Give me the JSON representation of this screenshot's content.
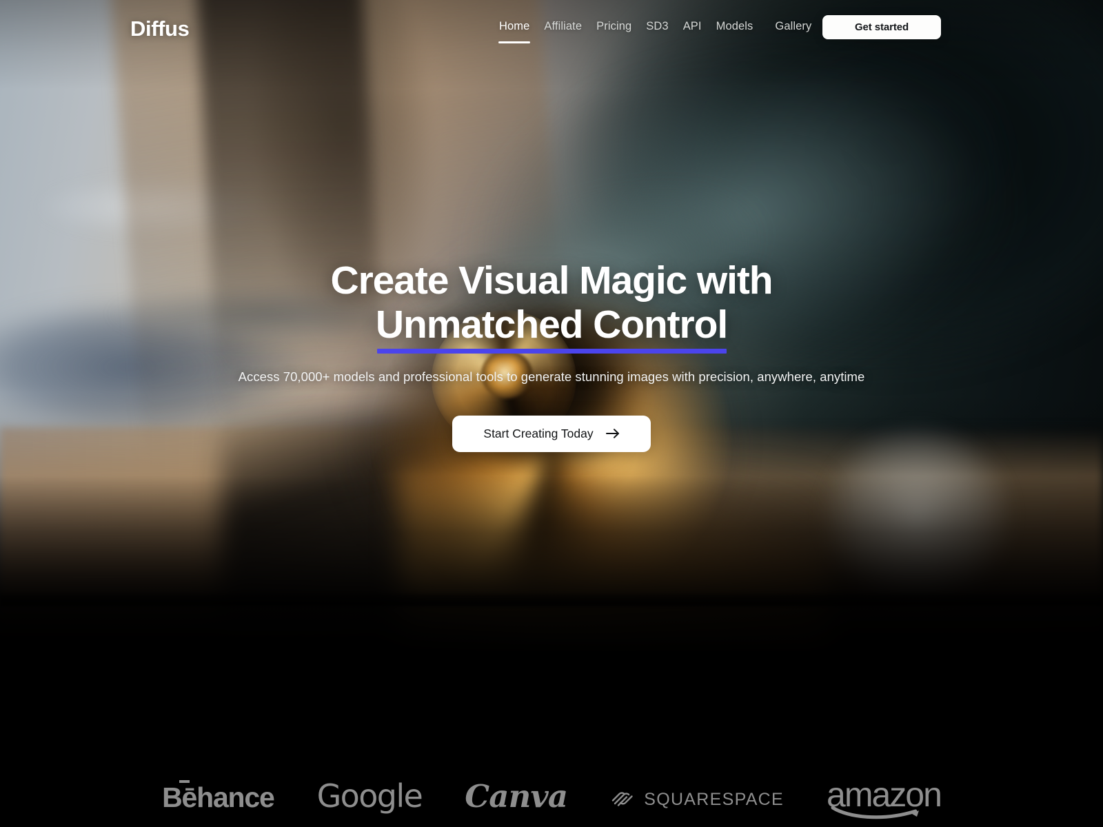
{
  "brand": {
    "logo_text": "Diffus"
  },
  "nav": {
    "links": [
      {
        "label": "Home",
        "active": true
      },
      {
        "label": "Affiliate",
        "active": false
      },
      {
        "label": "Pricing",
        "active": false
      },
      {
        "label": "SD3",
        "active": false
      },
      {
        "label": "API",
        "active": false
      },
      {
        "label": "Models",
        "active": false
      },
      {
        "label": "Gallery",
        "active": false
      }
    ],
    "cta_label": "Get started"
  },
  "hero": {
    "headline_line1": "Create Visual Magic with",
    "headline_line2": "Unmatched Control",
    "underline_color": "#4b44ec",
    "subheadline": "Access 70,000+ models and professional tools to generate stunning images with precision, anywhere, anytime",
    "cta_label": "Start Creating Today",
    "cta_icon": "arrow-right-icon"
  },
  "logo_strip": {
    "logos": [
      {
        "name": "behance",
        "label": "Bēhance"
      },
      {
        "name": "google",
        "label": "Google"
      },
      {
        "name": "canva",
        "label": "Canva"
      },
      {
        "name": "squarespace",
        "label": "SQUARESPACE"
      },
      {
        "name": "amazon",
        "label": "amazon"
      }
    ],
    "color": "#8e8e8e"
  },
  "colors": {
    "background": "#000000",
    "accent_underline": "#4b44ec",
    "cta_background": "#ffffff",
    "cta_text": "#111315",
    "nav_link": "#d6d8d6",
    "nav_link_active": "#ffffff"
  }
}
